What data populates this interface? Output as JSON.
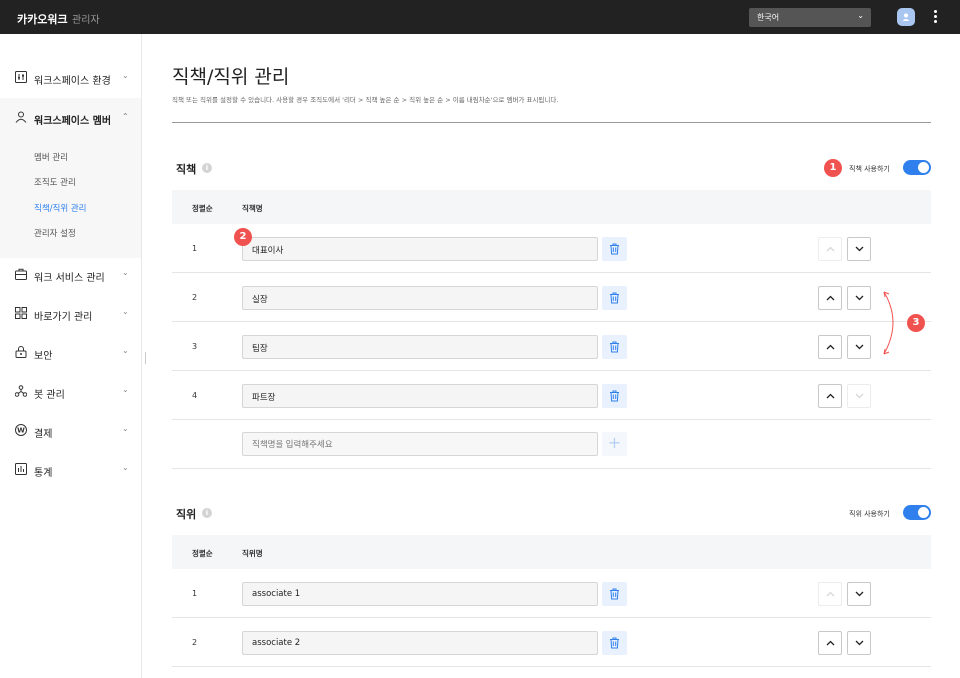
{
  "header": {
    "brand": "카카오워크",
    "sub": "관리자",
    "language": "한국어"
  },
  "sidebar": {
    "items": [
      {
        "label": "워크스페이스 환경",
        "icon": "sliders-icon"
      },
      {
        "label": "워크스페이스 멤버",
        "icon": "person-icon"
      },
      {
        "label": "워크 서비스 관리",
        "icon": "briefcase-icon"
      },
      {
        "label": "바로가기 관리",
        "icon": "grid-icon"
      },
      {
        "label": "보안",
        "icon": "lock-icon"
      },
      {
        "label": "봇 관리",
        "icon": "bot-icon"
      },
      {
        "label": "결제",
        "icon": "won-icon"
      },
      {
        "label": "통계",
        "icon": "chart-icon"
      }
    ],
    "sub_items": [
      "멤버 관리",
      "조직도 관리",
      "직책/직위 관리",
      "관리자 설정"
    ]
  },
  "page": {
    "title": "직책/직위 관리",
    "description": "직책 또는 직위를 설정할 수 있습니다. 사용할 경우 조직도에서 '리더 > 직책 높은 순 > 직위 높은 순 > 이름 내림차순'으로 멤버가 표시됩니다."
  },
  "duty": {
    "title": "직책",
    "toggle_label": "직책 사용하기",
    "col_order": "정렬순",
    "col_name": "직책명",
    "rows": [
      {
        "order": "1",
        "name": "대표이사"
      },
      {
        "order": "2",
        "name": "실장"
      },
      {
        "order": "3",
        "name": "팀장"
      },
      {
        "order": "4",
        "name": "파트장"
      }
    ],
    "placeholder": "직책명을 입력해주세요"
  },
  "rank": {
    "title": "직위",
    "toggle_label": "직위 사용하기",
    "col_order": "정렬순",
    "col_name": "직위명",
    "rows": [
      {
        "order": "1",
        "name": "associate 1"
      },
      {
        "order": "2",
        "name": "associate 2"
      }
    ]
  },
  "annotations": [
    "1",
    "2",
    "3"
  ],
  "colors": {
    "accent": "#2f80ed",
    "badge": "#f0524f",
    "topbar": "#222222"
  }
}
